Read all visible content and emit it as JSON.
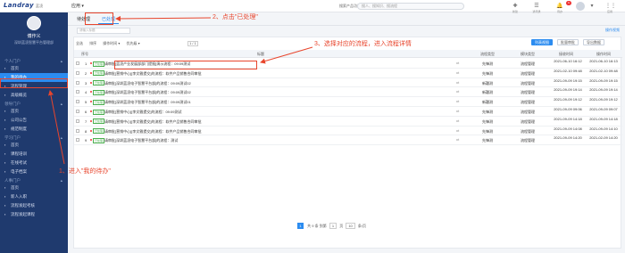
{
  "topbar": {
    "logo": "Landray",
    "logo_sub": "蓝凌",
    "app_menu": "应用 ▾",
    "search_label": "搜索产品功能",
    "search_placeholder": "搜人、搜知识、搜流程",
    "icon_labels": [
      "新建",
      "通讯录",
      "待办",
      "应用"
    ],
    "badge": "6"
  },
  "sidebar": {
    "user_name": "傅作义",
    "user_dept": "深圳蓝凌智慧平台管理部",
    "sections": [
      {
        "title": "个人门户",
        "items": [
          "首页",
          "我的待办",
          "流程管理",
          "高级概览"
        ]
      },
      {
        "title": "领导门户",
        "items": [
          "首页",
          "公司公告",
          "规范制度"
        ]
      },
      {
        "title": "学习门户",
        "items": [
          "首页",
          "课程培训",
          "在线考试",
          "电子档案"
        ]
      },
      {
        "title": "人事门户",
        "items": [
          "首页",
          "新人入职",
          "流程发起考核",
          "流程发起课程"
        ]
      }
    ]
  },
  "main": {
    "tabs": [
      "待处理",
      "已处理"
    ],
    "filter_placeholder": "请输入标题",
    "toolbar_right": "操作视频",
    "list_toolbar": [
      "全选",
      "排序",
      "操作时间 ▾",
      "优先级 ▾"
    ],
    "page_indicator": "1 / 1",
    "buttons": [
      "列表视图",
      "批量审批",
      "导出数据"
    ],
    "columns": [
      "序号",
      "标题",
      "流程类型",
      "模块类型",
      "接收时间",
      "操作时间"
    ],
    "rows": [
      {
        "no": "1",
        "tag": "已处理",
        "title": "请审批[蓝凌产业发展部部门提报]演示流程：09:09测试",
        "type": "先锋测",
        "module": "流程管理",
        "recv": "2021-06-10 16:12",
        "op": "2021-06-10 16:13"
      },
      {
        "no": "2",
        "tag": "已处理",
        "title": "请审批[营销中心][李文雅提交]的流程：软件产品销售合同审批",
        "type": "先锋测",
        "module": "流程管理",
        "recv": "2021-02-10 09:48",
        "op": "2021-02-10 09:48"
      },
      {
        "no": "3",
        "tag": "已处理",
        "title": "请审批[深圳蓝凌电子智慧平台部]的流程：09:09测试02",
        "type": "新疆测",
        "module": "流程管理",
        "recv": "2021-09-09 19:15",
        "op": "2021-09-09 19:15"
      },
      {
        "no": "4",
        "tag": "已处理",
        "title": "请审批[深圳蓝凌电子智慧平台部]的流程：09:09测试02",
        "type": "新疆测",
        "module": "流程管理",
        "recv": "2021-09-09 19:14",
        "op": "2021-09-09 19:14"
      },
      {
        "no": "5",
        "tag": "已处理",
        "title": "请审批[深圳蓝凌电子智慧平台部]的流程：09:09测试01",
        "type": "新疆测",
        "module": "流程管理",
        "recv": "2021-09-09 19:12",
        "op": "2021-09-09 19:12"
      },
      {
        "no": "6",
        "tag": "已处理",
        "title": "请审批[营销中心][李文雅提交]的流程：09:09测试",
        "type": "先锋测",
        "module": "流程管理",
        "recv": "2021-09-09 09:06",
        "op": "2021-09-09 09:07"
      },
      {
        "no": "7",
        "tag": "已处理",
        "title": "请审批[营销中心][李文雅提交]的流程：软件产品销售合同审批",
        "type": "先锋测",
        "module": "流程管理",
        "recv": "2021-09-09 14:18",
        "op": "2021-09-09 14:18"
      },
      {
        "no": "8",
        "tag": "已处理",
        "title": "请审批[营销中心][李文雅提交]的流程：软件产品销售合同审批",
        "type": "先锋测",
        "module": "流程管理",
        "recv": "2021-09-09 14:08",
        "op": "2021-09-09 14:10"
      },
      {
        "no": "9",
        "tag": "已处理",
        "title": "请审批[深圳蓝凌电子智慧平台部]的流程：测试",
        "type": "先锋测",
        "module": "流程管理",
        "recv": "2021-09-09 14:20",
        "op": "2021-02-09 14:20"
      }
    ],
    "pager": {
      "current": "1",
      "total": "共 9 条",
      "goto": "到第",
      "page_unit": "页",
      "size": "10",
      "size_unit": "条/页"
    }
  },
  "annotations": {
    "step1": "1、进入\"我的待办\"",
    "step2": "2、点击\"已处理\"",
    "step3": "3、选择对应的流程，进入流程详情",
    "color": "#e8452c"
  }
}
